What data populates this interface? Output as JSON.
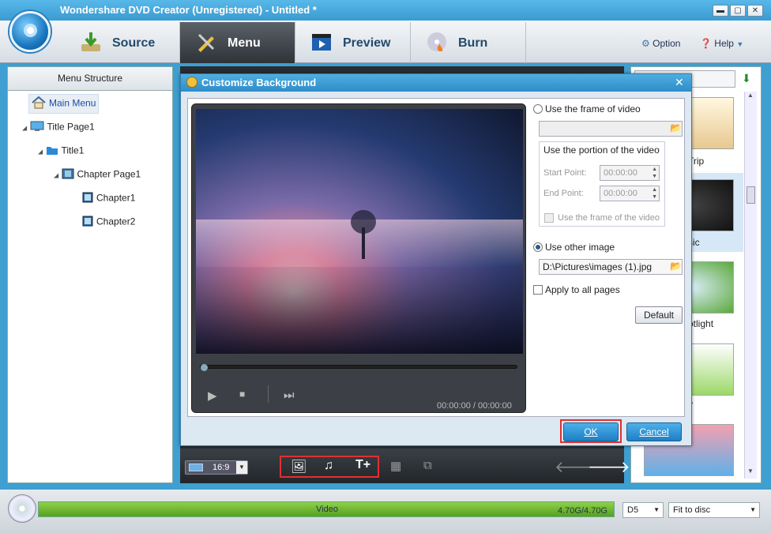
{
  "app": {
    "title": "Wondershare DVD Creator (Unregistered) - Untitled *"
  },
  "window_controls": {
    "minimize": "▬",
    "maximize": "▢",
    "close": "✕"
  },
  "nav": {
    "tabs": [
      {
        "label": "Source",
        "icon": "source-download-icon"
      },
      {
        "label": "Menu",
        "icon": "menu-edit-icon",
        "active": true
      },
      {
        "label": "Preview",
        "icon": "preview-clapper-icon"
      },
      {
        "label": "Burn",
        "icon": "burn-disc-icon"
      }
    ],
    "option": "Option",
    "help": "Help"
  },
  "left_panel": {
    "header": "Menu Structure",
    "tree": [
      {
        "label": "Main Menu",
        "icon": "home-icon",
        "selected": true
      },
      {
        "label": "Title Page1",
        "icon": "monitor-icon"
      },
      {
        "label": "Title1",
        "icon": "folder-icon"
      },
      {
        "label": "Chapter Page1",
        "icon": "film-icon"
      },
      {
        "label": "Chapter1",
        "icon": "filmstrip-icon"
      },
      {
        "label": "Chapter2",
        "icon": "filmstrip-icon"
      }
    ]
  },
  "right_panel": {
    "templates": [
      "Trip",
      "sic",
      "otlight",
      "y",
      ""
    ]
  },
  "dialog": {
    "title": "Customize Background",
    "use_frame_of_video": "Use the frame of video",
    "portion_group": "Use the portion of the video",
    "start_point_label": "Start Point:",
    "start_point_value": "00:00:00",
    "end_point_label": "End Point:",
    "end_point_value": "00:00:00",
    "portion_frame": "Use the frame of the video",
    "use_other_image": "Use other image",
    "image_path": "D:\\Pictures\\images (1).jpg",
    "apply_all": "Apply to all pages",
    "default_btn": "Default",
    "ok_btn": "OK",
    "cancel_btn": "Cancel",
    "timecode": "00:00:00 / 00:00:00"
  },
  "bottom_bar": {
    "aspect": "16:9"
  },
  "status": {
    "progress_label": "Video",
    "progress_size": "4.70G/4.70G",
    "disc_type": "D5",
    "fit": "Fit to disc"
  }
}
